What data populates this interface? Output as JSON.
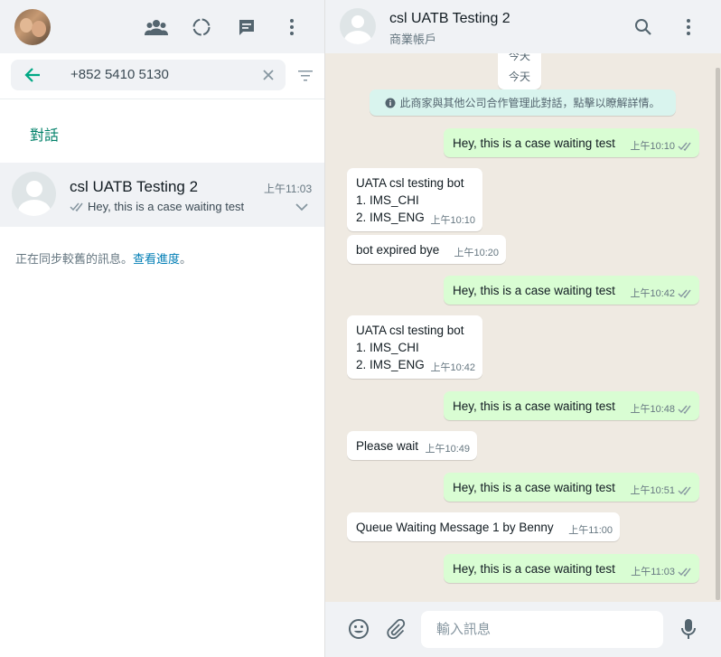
{
  "sidebar": {
    "search": {
      "value": "+852 5410 5130"
    },
    "section_label": "對話",
    "chat": {
      "name": "csl UATB Testing 2",
      "time": "上午11:03",
      "preview": "Hey, this is a case waiting test"
    },
    "sync": {
      "text": "正在同步較舊的訊息。",
      "link": "查看進度",
      "suffix": "。"
    }
  },
  "conversation": {
    "contact_name": "csl UATB Testing 2",
    "contact_sub": "商業帳戶",
    "date_top": "今天",
    "date_label": "今天",
    "business_notice": "此商家與其他公司合作管理此對話，點擊以瞭解詳情。",
    "messages": [
      {
        "dir": "out",
        "text": "Hey, this is a case waiting test",
        "time": "上午10:10"
      },
      {
        "dir": "in",
        "text": "UATA csl testing bot\n1. IMS_CHI\n2. IMS_ENG",
        "time": "上午10:10"
      },
      {
        "dir": "in",
        "text": "bot expired bye",
        "time": "上午10:20"
      },
      {
        "dir": "out",
        "text": "Hey, this is a case waiting test",
        "time": "上午10:42"
      },
      {
        "dir": "in",
        "text": "UATA csl testing bot\n1. IMS_CHI\n2. IMS_ENG",
        "time": "上午10:42"
      },
      {
        "dir": "out",
        "text": "Hey, this is a case waiting test",
        "time": "上午10:48"
      },
      {
        "dir": "in",
        "text": "Please wait",
        "time": "上午10:49"
      },
      {
        "dir": "out",
        "text": "Hey, this is a case waiting test",
        "time": "上午10:51"
      },
      {
        "dir": "in",
        "text": "Queue Waiting Message 1 by Benny",
        "time": "上午11:00"
      },
      {
        "dir": "out",
        "text": "Hey, this is a case waiting test",
        "time": "上午11:03"
      }
    ]
  },
  "composer": {
    "placeholder": "輸入訊息"
  },
  "colors": {
    "accent": "#008069",
    "outgoing_bubble": "#d9fdd3",
    "incoming_bubble": "#ffffff",
    "link": "#027eb5"
  }
}
